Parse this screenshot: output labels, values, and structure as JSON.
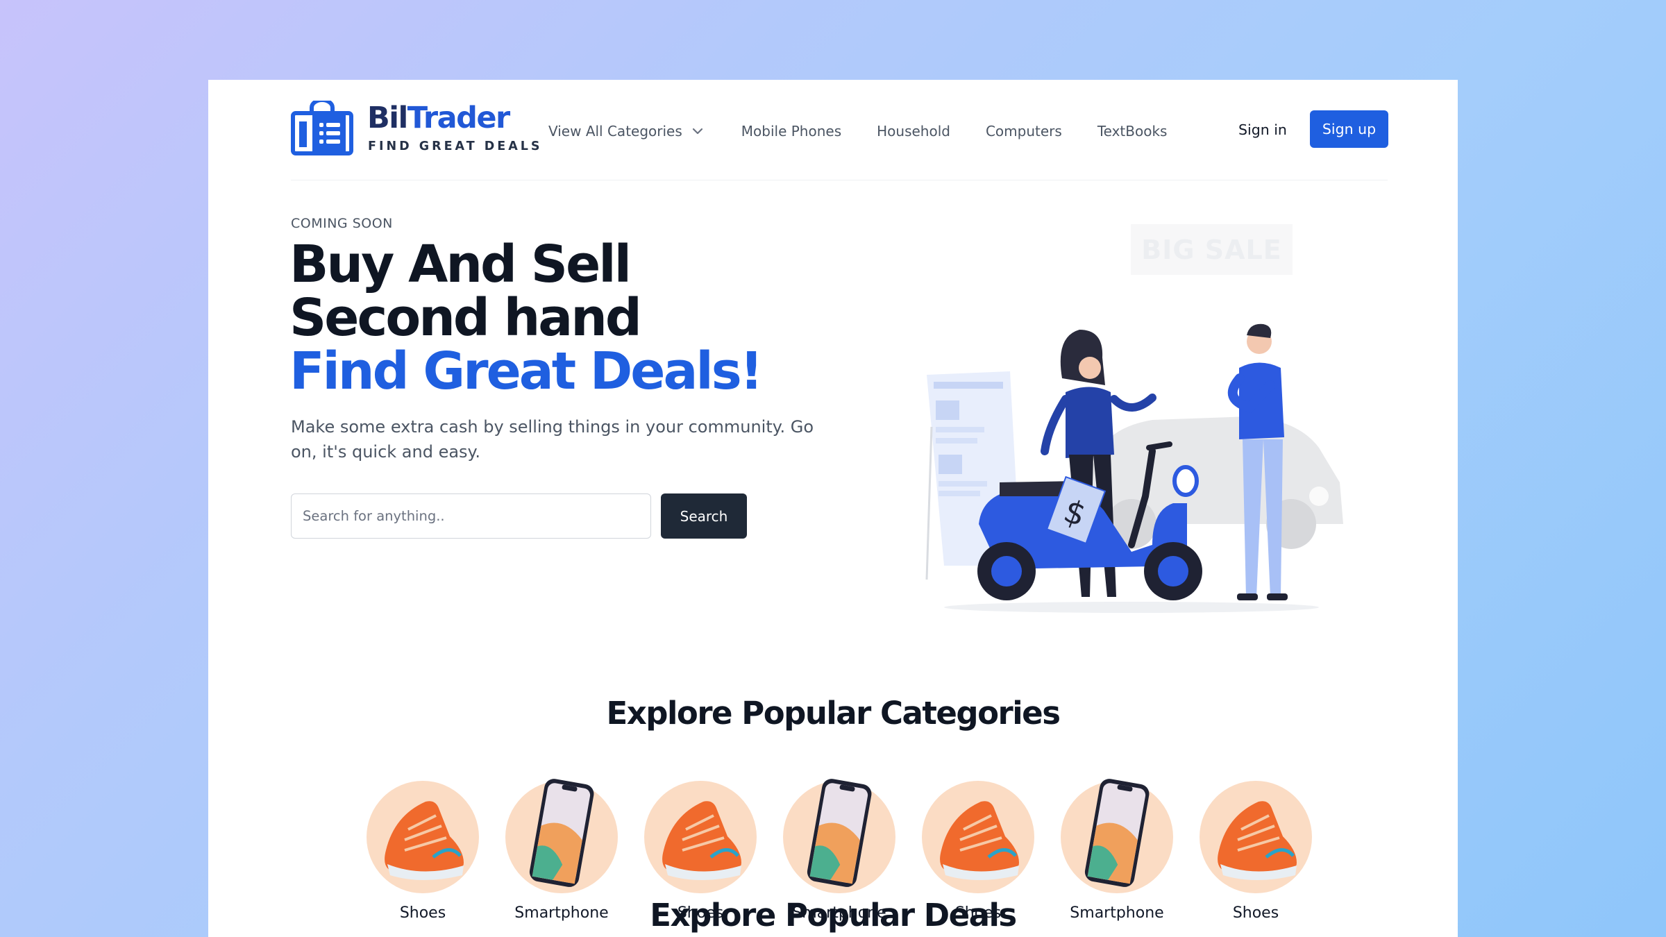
{
  "brand": {
    "name_a": "Bil",
    "name_b": "Trader",
    "tagline": "FIND GREAT DEALS"
  },
  "nav": {
    "items": [
      {
        "label": "View All Categories",
        "has_dropdown": true
      },
      {
        "label": "Mobile Phones"
      },
      {
        "label": "Household"
      },
      {
        "label": "Computers"
      },
      {
        "label": "TextBooks"
      }
    ],
    "signin": "Sign in",
    "signup": "Sign up"
  },
  "hero": {
    "eyebrow": "COMING SOON",
    "title_line1": "Buy And Sell Second hand",
    "title_line2": "Find Great Deals!",
    "description": "Make some extra cash by selling things in your community. Go on, it's quick and easy.",
    "search_placeholder": "Search for anything..",
    "search_button": "Search",
    "illustration_sign": "BIG SALE"
  },
  "categories": {
    "title": "Explore Popular Categories",
    "items": [
      {
        "label": "Shoes",
        "icon": "shoe-icon"
      },
      {
        "label": "Smartphone",
        "icon": "smartphone-icon"
      },
      {
        "label": "Shoes",
        "icon": "shoe-icon"
      },
      {
        "label": "Smartphone",
        "icon": "smartphone-icon"
      },
      {
        "label": "Shoes",
        "icon": "shoe-icon"
      },
      {
        "label": "Smartphone",
        "icon": "smartphone-icon"
      },
      {
        "label": "Shoes",
        "icon": "shoe-icon"
      }
    ]
  },
  "deals": {
    "title": "Explore Popular Deals"
  },
  "colors": {
    "primary": "#1f5fe0",
    "dark": "#1f2937",
    "category_bg": "#fbdcc4"
  }
}
